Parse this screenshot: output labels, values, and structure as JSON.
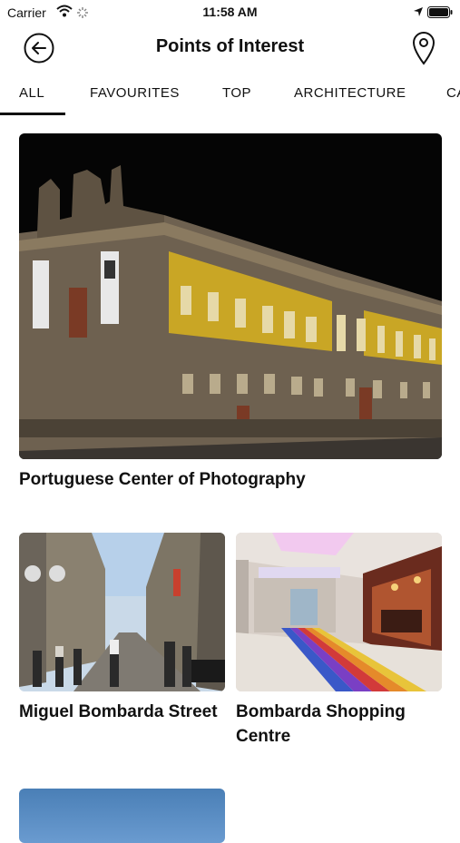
{
  "status_bar": {
    "carrier": "Carrier",
    "time": "11:58 AM"
  },
  "header": {
    "title": "Points of Interest"
  },
  "tabs": [
    {
      "label": "ALL",
      "active": true
    },
    {
      "label": "FAVOURITES"
    },
    {
      "label": "TOP"
    },
    {
      "label": "ARCHITECTURE"
    },
    {
      "label": "CA"
    }
  ],
  "places": [
    {
      "name": "Portuguese Center of Photography"
    },
    {
      "name": "Miguel Bombarda Street"
    },
    {
      "name": "Bombarda Shopping Centre"
    }
  ],
  "icons": {
    "back": "arrow-left-icon",
    "map": "map-pin-icon",
    "wifi": "wifi-icon",
    "battery": "battery-icon",
    "location": "location-arrow-icon"
  }
}
